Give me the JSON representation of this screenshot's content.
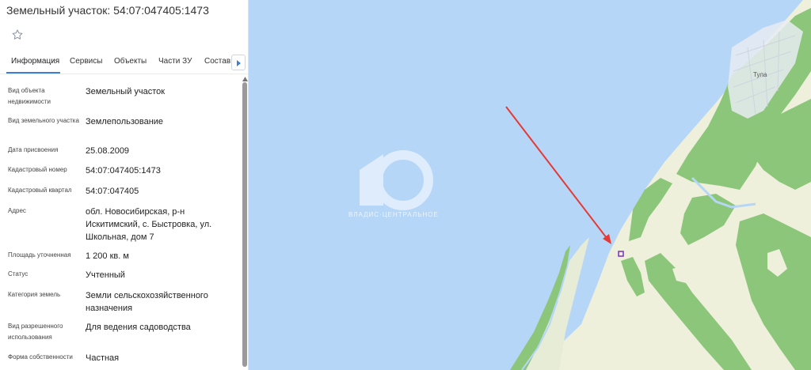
{
  "header": {
    "title": "Земельный участок: 54:07:047405:1473"
  },
  "tabs": [
    {
      "label": "Информация",
      "active": true
    },
    {
      "label": "Сервисы",
      "active": false
    },
    {
      "label": "Объекты",
      "active": false
    },
    {
      "label": "Части ЗУ",
      "active": false
    },
    {
      "label": "Состав",
      "active": false
    }
  ],
  "info": [
    {
      "label": "Вид объекта недвижимости",
      "value": "Земельный участок"
    },
    {
      "label": "Вид земельного участка",
      "value": "Землепользование"
    },
    {
      "label": "Дата присвоения",
      "value": "25.08.2009"
    },
    {
      "label": "Кадастровый номер",
      "value": "54:07:047405:1473"
    },
    {
      "label": "Кадастровый квартал",
      "value": "54:07:047405"
    },
    {
      "label": "Адрес",
      "value": "обл. Новосибирская, р-н Искитимский, с. Быстровка, ул. Школьная, дом 7"
    },
    {
      "label": "Площадь уточненная",
      "value": "1 200 кв. м"
    },
    {
      "label": "Статус",
      "value": "Учтенный"
    },
    {
      "label": "Категория земель",
      "value": "Земли сельскохозяйственного назначения"
    },
    {
      "label": "Вид разрешенного использования",
      "value": "Для ведения садоводства"
    },
    {
      "label": "Форма собственности",
      "value": "Частная"
    }
  ],
  "map": {
    "place_label": "Тула",
    "watermark": "ВЛАДИС·ЦЕНТРАЛЬНОЕ",
    "colors": {
      "water": "#b6d6f7",
      "land": "#eef0dc",
      "forest": "#8cc67a",
      "arrow": "#e53935",
      "parcel": "#7b2fbe",
      "accent": "#3b7dd8"
    }
  },
  "icons": {
    "favorite": "star-icon",
    "tabs_scroll": "chevron-right-icon"
  }
}
